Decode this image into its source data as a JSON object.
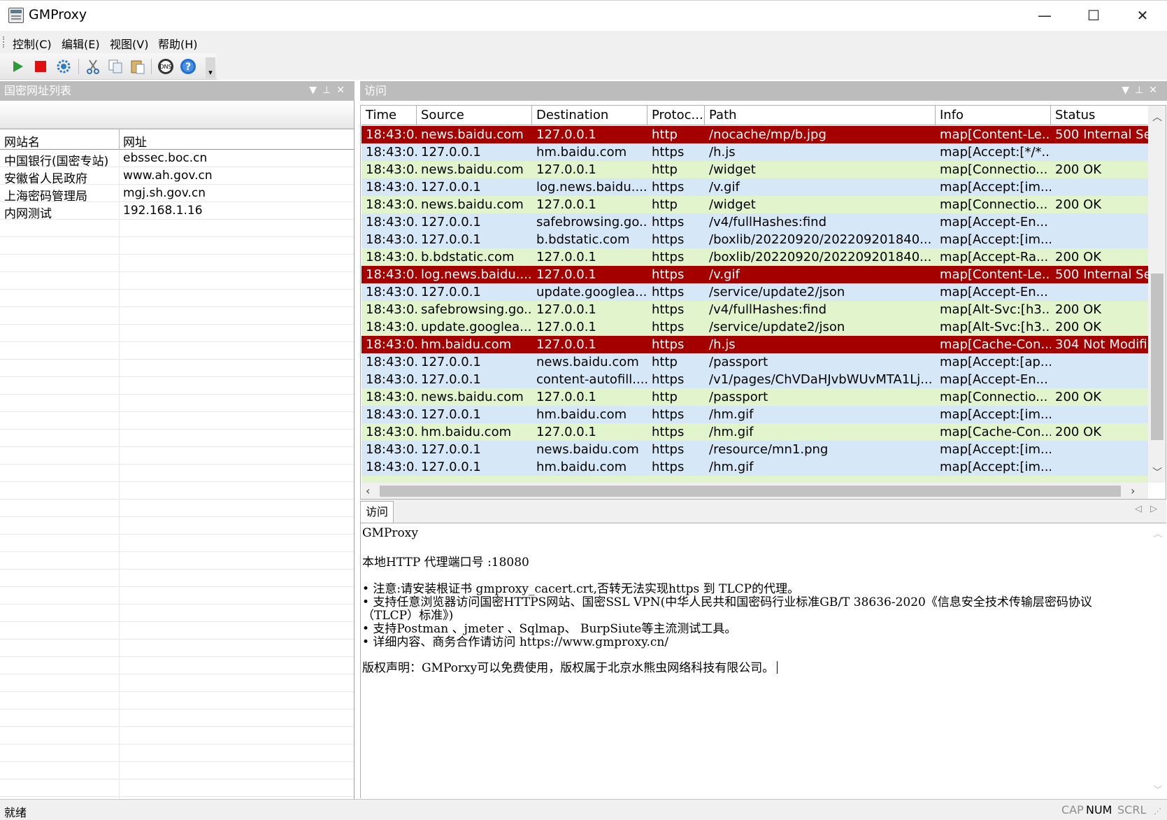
{
  "window": {
    "title": "GMProxy",
    "minimize": "—",
    "maximize": "☐",
    "close": "✕"
  },
  "menu": [
    {
      "label": "控制(C)"
    },
    {
      "label": "编辑(E)"
    },
    {
      "label": "视图(V)"
    },
    {
      "label": "帮助(H)"
    }
  ],
  "toolbar": {
    "start_icon": "play-icon",
    "stop_icon": "stop-icon",
    "settings_icon": "gear-icon",
    "cut_icon": "scissors-icon",
    "copy_icon": "copy-icon",
    "paste_icon": "paste-icon",
    "dns_icon": "dns-icon",
    "help_icon": "help-icon",
    "dns_label": "DNS"
  },
  "left_pane": {
    "title": "国密网址列表",
    "columns": [
      "网站名",
      "网址"
    ],
    "rows": [
      {
        "name": "中国银行(国密专站)",
        "url": "ebssec.boc.cn"
      },
      {
        "name": "安徽省人民政府",
        "url": "www.ah.gov.cn"
      },
      {
        "name": "上海密码管理局",
        "url": "mgj.sh.gov.cn"
      },
      {
        "name": "内网测试",
        "url": "192.168.1.16"
      }
    ]
  },
  "right_pane": {
    "title": "访问",
    "columns": [
      "Time",
      "Source",
      "Destination",
      "Protoc...",
      "Path",
      "Info",
      "Status"
    ],
    "rows": [
      {
        "color": "red",
        "time": "18:43:0...",
        "source": "news.baidu.com",
        "destination": "127.0.0.1",
        "protocol": "http",
        "path": "/nocache/mp/b.jpg",
        "info": "map[Content-Le...",
        "status": "500 Internal Se"
      },
      {
        "color": "blue",
        "time": "18:43:0...",
        "source": "127.0.0.1",
        "destination": "hm.baidu.com",
        "protocol": "https",
        "path": "/h.js",
        "info": "map[Accept:[*/*...",
        "status": ""
      },
      {
        "color": "green",
        "time": "18:43:0...",
        "source": "news.baidu.com",
        "destination": "127.0.0.1",
        "protocol": "http",
        "path": "/widget",
        "info": "map[Connectio...",
        "status": "200 OK"
      },
      {
        "color": "blue",
        "time": "18:43:0...",
        "source": "127.0.0.1",
        "destination": "log.news.baidu....",
        "protocol": "https",
        "path": "/v.gif",
        "info": "map[Accept:[im...",
        "status": ""
      },
      {
        "color": "green",
        "time": "18:43:0...",
        "source": "news.baidu.com",
        "destination": "127.0.0.1",
        "protocol": "http",
        "path": "/widget",
        "info": "map[Connectio...",
        "status": "200 OK"
      },
      {
        "color": "blue",
        "time": "18:43:0...",
        "source": "127.0.0.1",
        "destination": "safebrowsing.go...",
        "protocol": "https",
        "path": "/v4/fullHashes:find",
        "info": "map[Accept-En...",
        "status": ""
      },
      {
        "color": "blue",
        "time": "18:43:0...",
        "source": "127.0.0.1",
        "destination": "b.bdstatic.com",
        "protocol": "https",
        "path": "/boxlib/20220920/202209201840...",
        "info": "map[Accept:[im...",
        "status": ""
      },
      {
        "color": "green",
        "time": "18:43:0...",
        "source": "b.bdstatic.com",
        "destination": "127.0.0.1",
        "protocol": "https",
        "path": "/boxlib/20220920/202209201840...",
        "info": "map[Accept-Ra...",
        "status": "200 OK"
      },
      {
        "color": "red",
        "time": "18:43:0...",
        "source": "log.news.baidu....",
        "destination": "127.0.0.1",
        "protocol": "https",
        "path": "/v.gif",
        "info": "map[Content-Le...",
        "status": "500 Internal Se"
      },
      {
        "color": "blue",
        "time": "18:43:0...",
        "source": "127.0.0.1",
        "destination": "update.googlea...",
        "protocol": "https",
        "path": "/service/update2/json",
        "info": "map[Accept-En...",
        "status": ""
      },
      {
        "color": "green",
        "time": "18:43:0...",
        "source": "safebrowsing.go...",
        "destination": "127.0.0.1",
        "protocol": "https",
        "path": "/v4/fullHashes:find",
        "info": "map[Alt-Svc:[h3...",
        "status": "200 OK"
      },
      {
        "color": "green",
        "time": "18:43:0...",
        "source": "update.googlea...",
        "destination": "127.0.0.1",
        "protocol": "https",
        "path": "/service/update2/json",
        "info": "map[Alt-Svc:[h3...",
        "status": "200 OK"
      },
      {
        "color": "red",
        "time": "18:43:0...",
        "source": "hm.baidu.com",
        "destination": "127.0.0.1",
        "protocol": "https",
        "path": "/h.js",
        "info": "map[Cache-Con...",
        "status": "304 Not Modifi"
      },
      {
        "color": "blue",
        "time": "18:43:0...",
        "source": "127.0.0.1",
        "destination": "news.baidu.com",
        "protocol": "http",
        "path": "/passport",
        "info": "map[Accept:[ap...",
        "status": ""
      },
      {
        "color": "blue",
        "time": "18:43:0...",
        "source": "127.0.0.1",
        "destination": "content-autofill....",
        "protocol": "https",
        "path": "/v1/pages/ChVDaHJvbWUvMTA1Lj...",
        "info": "map[Accept-En...",
        "status": ""
      },
      {
        "color": "green",
        "time": "18:43:0...",
        "source": "news.baidu.com",
        "destination": "127.0.0.1",
        "protocol": "http",
        "path": "/passport",
        "info": "map[Connectio...",
        "status": "200 OK"
      },
      {
        "color": "blue",
        "time": "18:43:0...",
        "source": "127.0.0.1",
        "destination": "hm.baidu.com",
        "protocol": "https",
        "path": "/hm.gif",
        "info": "map[Accept:[im...",
        "status": ""
      },
      {
        "color": "green",
        "time": "18:43:0...",
        "source": "hm.baidu.com",
        "destination": "127.0.0.1",
        "protocol": "https",
        "path": "/hm.gif",
        "info": "map[Cache-Con...",
        "status": "200 OK"
      },
      {
        "color": "blue",
        "time": "18:43:0...",
        "source": "127.0.0.1",
        "destination": "news.baidu.com",
        "protocol": "https",
        "path": "/resource/mn1.png",
        "info": "map[Accept:[im...",
        "status": ""
      },
      {
        "color": "blue",
        "time": "18:43:0...",
        "source": "127.0.0.1",
        "destination": "hm.baidu.com",
        "protocol": "https",
        "path": "/hm.gif",
        "info": "map[Accept:[im...",
        "status": ""
      }
    ]
  },
  "tabs": {
    "active": "访问"
  },
  "output": {
    "lines": [
      "GMProxy",
      "",
      "本地HTTP 代理端口号 :18080",
      "",
      "• 注意:请安装根证书 gmproxy_cacert.crt,否转无法实现https 到 TLCP的代理。",
      "• 支持任意浏览器访问国密HTTPS网站、国密SSL VPN(中华人民共和国密码行业标准GB/T 38636-2020《信息安全技术传输层密码协议",
      "（TLCP）标准》)",
      "• 支持Postman 、jmeter 、Sqlmap、 BurpSiute等主流测试工具。",
      "• 详细内容、商务合作请访问 https://www.gmproxy.cn/",
      "",
      "版权声明：GMPorxy可以免费使用，版权属于北京水熊虫网络科技有限公司。"
    ]
  },
  "statusbar": {
    "text": "就绪",
    "cap": "CAP",
    "num": "NUM",
    "scrl": "SCRL"
  },
  "colors": {
    "row_red": "#a50000",
    "row_blue": "#d6e8f7",
    "row_green": "#e1f4cc",
    "pane_header": "#bcbcbc"
  }
}
